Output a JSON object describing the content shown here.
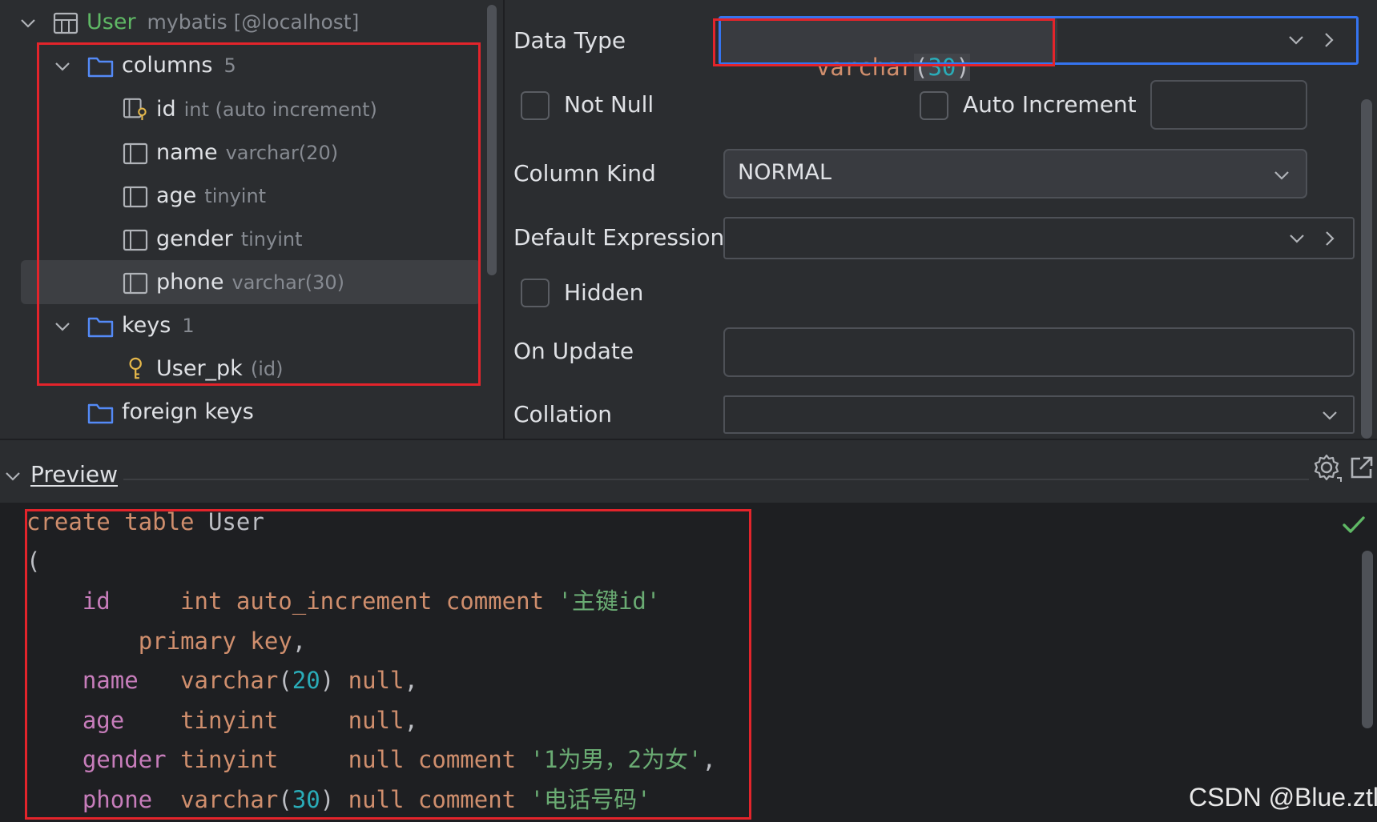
{
  "tree": {
    "table_name": "User",
    "table_source": "mybatis [@localhost]",
    "columns_label": "columns",
    "columns_count": "5",
    "columns": [
      {
        "name": "id",
        "type": "int (auto increment)",
        "icon": "primary-key-column-icon"
      },
      {
        "name": "name",
        "type": "varchar(20)",
        "icon": "column-icon"
      },
      {
        "name": "age",
        "type": "tinyint",
        "icon": "column-icon"
      },
      {
        "name": "gender",
        "type": "tinyint",
        "icon": "column-icon"
      },
      {
        "name": "phone",
        "type": "varchar(30)",
        "icon": "column-icon"
      }
    ],
    "keys_label": "keys",
    "keys_count": "1",
    "keys": [
      {
        "name": "User_pk",
        "detail": "(id)"
      }
    ],
    "foreign_keys_label": "foreign keys"
  },
  "properties": {
    "data_type_label": "Data Type",
    "data_type_value_name": "varchar",
    "data_type_value_open": "(",
    "data_type_value_num": "30",
    "data_type_value_close": ")",
    "not_null_label": "Not Null",
    "not_null_checked": false,
    "auto_increment_label": "Auto Increment",
    "auto_increment_checked": false,
    "auto_increment_value": "",
    "column_kind_label": "Column Kind",
    "column_kind_value": "NORMAL",
    "default_expression_label": "Default Expression",
    "default_expression_value": "",
    "hidden_label": "Hidden",
    "hidden_checked": false,
    "on_update_label": "On Update",
    "on_update_value": "",
    "collation_label": "Collation",
    "collation_value": ""
  },
  "preview": {
    "title": "Preview",
    "status": "valid",
    "code": {
      "l1_kw": "create table",
      "l1_name": " User",
      "l2": "(",
      "l3_col": "id",
      "l3_type": "int auto_increment comment",
      "l3_str": "'主键id'",
      "l4_kw": "primary key",
      "l4_end": ",",
      "l5_col": "name",
      "l5_type": "varchar",
      "l5_open": "(",
      "l5_num": "20",
      "l5_close": ")",
      "l5_null": "null",
      "l5_end": ",",
      "l6_col": "age",
      "l6_type": "tinyint",
      "l6_null": "null",
      "l6_end": ",",
      "l7_col": "gender",
      "l7_type": "tinyint",
      "l7_null": "null comment",
      "l7_str": "'1为男，2为女'",
      "l7_end": ",",
      "l8_col": "phone",
      "l8_type": "varchar",
      "l8_open": "(",
      "l8_num": "30",
      "l8_close": ")",
      "l8_null": "null comment",
      "l8_str": "'电话号码'"
    }
  },
  "watermark": "CSDN @Blue.ztl",
  "colors": {
    "annotation_red": "#e3242b",
    "focus_blue": "#3574f0",
    "keyword": "#cf8e6d",
    "identifier": "#c77dbb",
    "number": "#2aacb8",
    "string": "#6aab73",
    "table_green": "#5fb865"
  }
}
